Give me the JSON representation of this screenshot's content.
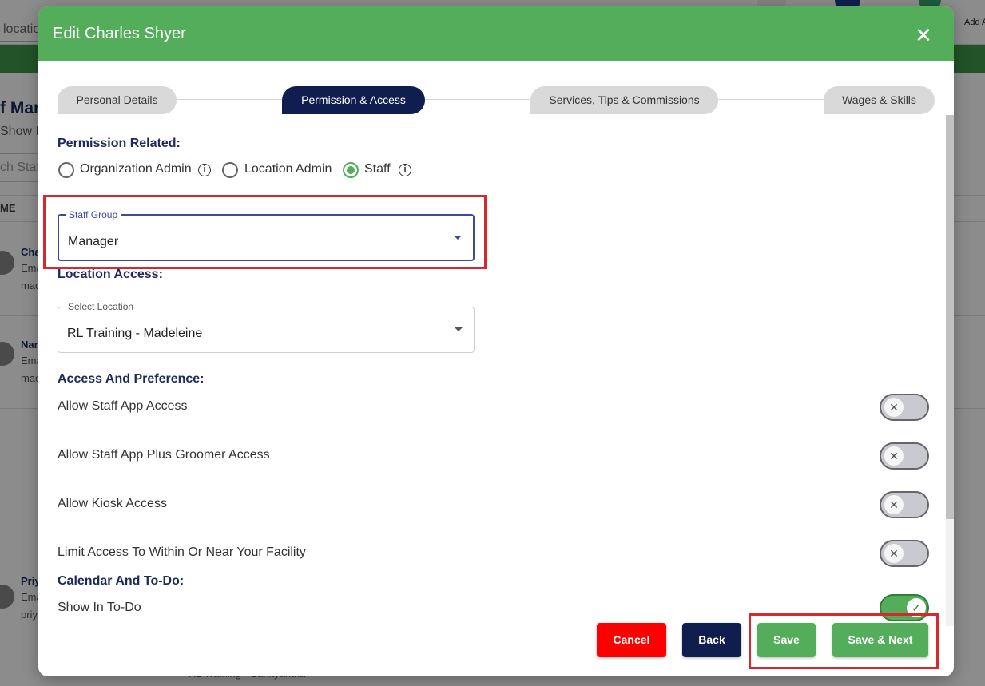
{
  "background": {
    "location_placeholder": "location",
    "add_label": "Add A",
    "page_heading": "f Man",
    "page_sub": "Show In",
    "search_placeholder": "ch Staf",
    "column_name": "ME",
    "rows": [
      {
        "name": "Cha",
        "email": "Ema",
        "extra": "mac"
      },
      {
        "name": "Nar",
        "email": "Ema",
        "extra": "mac"
      },
      {
        "name": "Priy",
        "email": "Ema",
        "extra": "priy"
      }
    ],
    "bottom_text": "RL Training - Sankyahtha"
  },
  "modal": {
    "title": "Edit Charles Shyer",
    "close_icon": "close-icon",
    "tabs": [
      {
        "label": "Personal Details",
        "active": false
      },
      {
        "label": "Permission & Access",
        "active": true
      },
      {
        "label": "Services, Tips & Commissions",
        "active": false
      },
      {
        "label": "Wages & Skills",
        "active": false
      }
    ],
    "permission": {
      "title": "Permission Related:",
      "options": [
        {
          "label": "Organization Admin",
          "checked": false,
          "info_icon": "info-icon"
        },
        {
          "label": "Location Admin",
          "checked": false
        },
        {
          "label": "Staff",
          "checked": true,
          "info_icon": "info-icon"
        }
      ]
    },
    "staff_group": {
      "legend": "Staff Group",
      "value": "Manager"
    },
    "location_access": {
      "title": "Location Access:",
      "legend": "Select Location",
      "value": "RL Training - Madeleine"
    },
    "access": {
      "title": "Access And Preference:",
      "items": [
        {
          "label": "Allow Staff App Access",
          "enabled": false
        },
        {
          "label": "Allow Staff App Plus Groomer Access",
          "enabled": false
        },
        {
          "label": "Allow Kiosk Access",
          "enabled": false
        },
        {
          "label": "Limit Access To Within Or Near Your Facility",
          "enabled": false
        }
      ]
    },
    "calendar": {
      "title": "Calendar And To-Do:",
      "items": [
        {
          "label": "Show In To-Do",
          "enabled": true
        }
      ]
    },
    "buttons": {
      "cancel": "Cancel",
      "back": "Back",
      "save": "Save",
      "save_next": "Save & Next"
    }
  },
  "colors": {
    "header_green": "#54ad5a",
    "navy": "#0f1d4f",
    "cancel_red": "#ff0000",
    "highlight_red": "#d8272d"
  }
}
